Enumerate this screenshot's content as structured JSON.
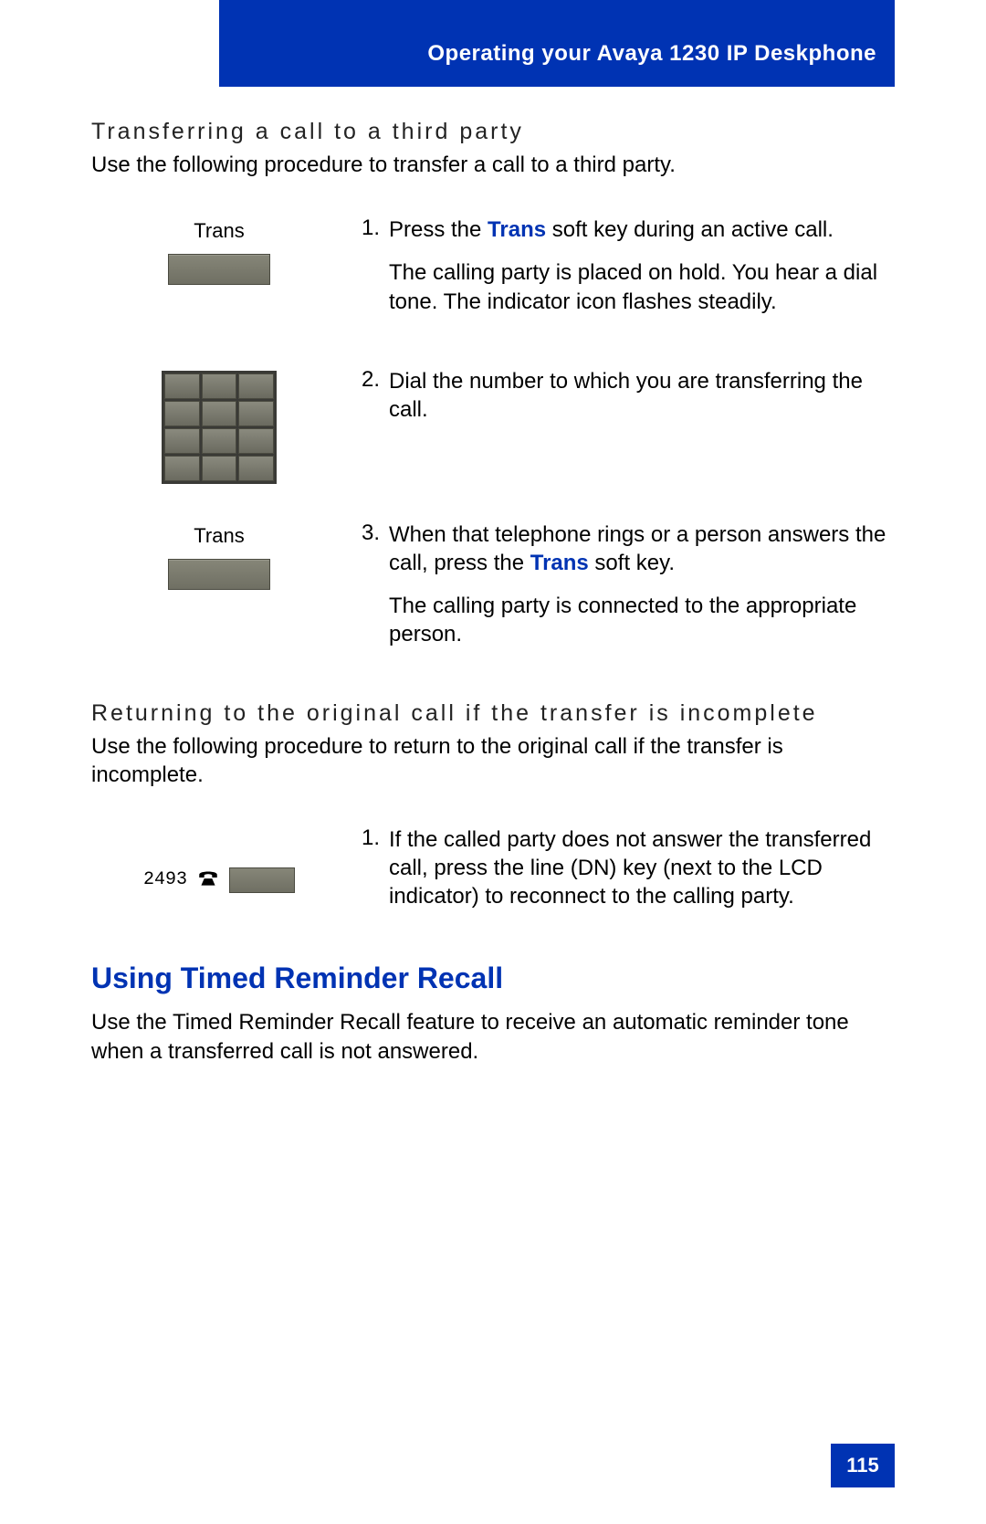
{
  "header": {
    "title": "Operating your Avaya 1230 IP Deskphone"
  },
  "section1": {
    "heading": "Transferring a call to a third party",
    "intro": "Use the following procedure to transfer a call to a third party.",
    "steps": [
      {
        "label": "Trans",
        "num": "1.",
        "line1a": "Press the ",
        "keyword": "Trans",
        "line1b": " soft key during an active call.",
        "para2": "The calling party is placed on hold. You hear a dial tone. The indicator icon flashes steadily."
      },
      {
        "label": "",
        "num": "2.",
        "line1": "Dial the number to which you are transferring the call."
      },
      {
        "label": "Trans",
        "num": "3.",
        "line1a": "When that telephone rings or a person answers the call, press the ",
        "keyword": "Trans",
        "line1b": " soft key.",
        "para2": "The calling party is connected to the appropriate person."
      }
    ]
  },
  "section2": {
    "heading": "Returning to the original call if the transfer is incomplete",
    "intro": "Use the following procedure to return to the original call if the transfer is incomplete.",
    "dn_number": "2493",
    "step_num": "1.",
    "step_text": "If the called party does not answer the transferred call, press the line (DN) key (next to the LCD indicator) to reconnect to the calling party."
  },
  "section3": {
    "heading": "Using Timed Reminder Recall",
    "intro": "Use the Timed Reminder Recall feature to receive an automatic reminder tone when a transferred call is not answered."
  },
  "page_number": "115"
}
